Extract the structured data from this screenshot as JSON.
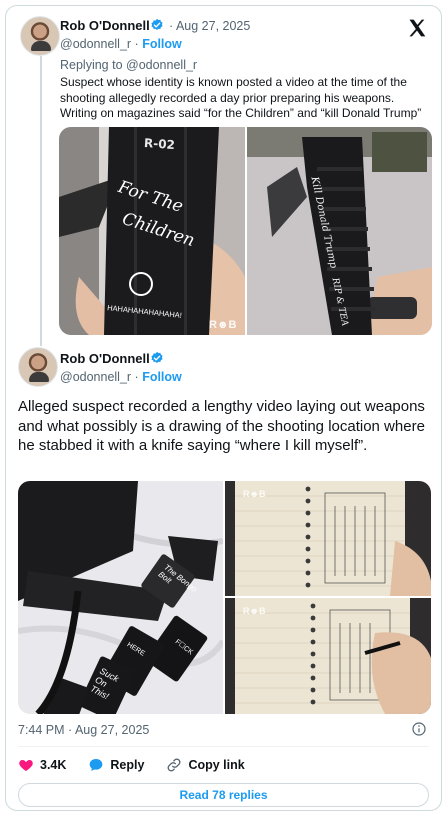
{
  "parent": {
    "author_name": "Rob O'Donnell",
    "date": "· Aug 27, 2025",
    "handle": "@odonnell_r",
    "separator": " · ",
    "follow": "Follow",
    "replying_prefix": "Replying to ",
    "replying_handle": "@odonnell_r",
    "text": "Suspect whose identity is known posted a video at the time of the shooting allegedly recorded a day prior preparing his weapons. Writing on magazines said “for the Children” and “kill Donald Trump”",
    "image_left": {
      "magazine_label": "R-02",
      "handwriting": [
        "For The",
        "Children"
      ],
      "magazine_bottom": "HAHAHAHAHAHAHA!",
      "watermark": "R☻B"
    },
    "image_right": {
      "handwriting": "Kill Donald Trump",
      "handwriting_2": "RIP & TEA"
    }
  },
  "main": {
    "author_name": "Rob O'Donnell",
    "handle": "@odonnell_r",
    "separator": " · ",
    "follow": "Follow",
    "text": "Alleged suspect recorded a lengthy video laying out weapons and what possibly is a drawing of the shooting location where he stabbed it with a knife saying “where I kill myself”.",
    "image_left": {
      "magazine_1": "The Bongo Bolt",
      "magazine_2": "F☐CK",
      "magazine_3": "Suck On This!",
      "magazine_4": "HERE"
    },
    "timestamp": "7:44 PM · Aug 27, 2025",
    "likes": "3.4K",
    "reply_label": "Reply",
    "copy_link_label": "Copy link",
    "read_replies": "Read 78 replies"
  },
  "colors": {
    "accent": "#1d9bf0",
    "like": "#f91880",
    "secondary_text": "#536471",
    "border": "#cfd9de"
  },
  "icons": [
    "x-logo-icon",
    "verified-badge-icon",
    "info-icon",
    "heart-icon",
    "reply-bubble-icon",
    "link-icon"
  ]
}
